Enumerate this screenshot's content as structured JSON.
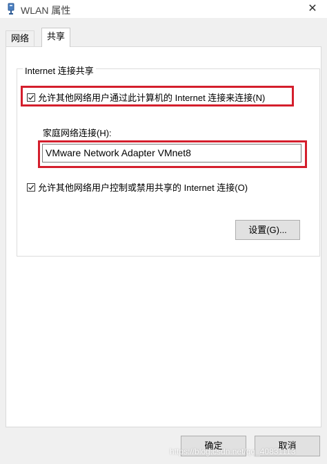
{
  "window": {
    "title": "WLAN 属性",
    "close_glyph": "✕",
    "icon": "network-adapter-icon"
  },
  "tabs": [
    {
      "label": "网络",
      "selected": false
    },
    {
      "label": "共享",
      "selected": true
    }
  ],
  "sharing": {
    "group_label": "Internet 连接共享",
    "allow_share": {
      "label": "允许其他网络用户通过此计算机的 Internet 连接来连接(N)",
      "checked": true
    },
    "home_network_label": "家庭网络连接(H):",
    "home_network_value": "VMware Network Adapter VMnet8",
    "allow_control": {
      "label": "允许其他网络用户控制或禁用共享的 Internet 连接(O)",
      "checked": true
    },
    "settings_button": "设置(G)..."
  },
  "buttons": {
    "ok": "确定",
    "cancel": "取消"
  },
  "highlight_color": "#d41e2c",
  "watermark": "https://blog.csdn.net/qq_40831113"
}
